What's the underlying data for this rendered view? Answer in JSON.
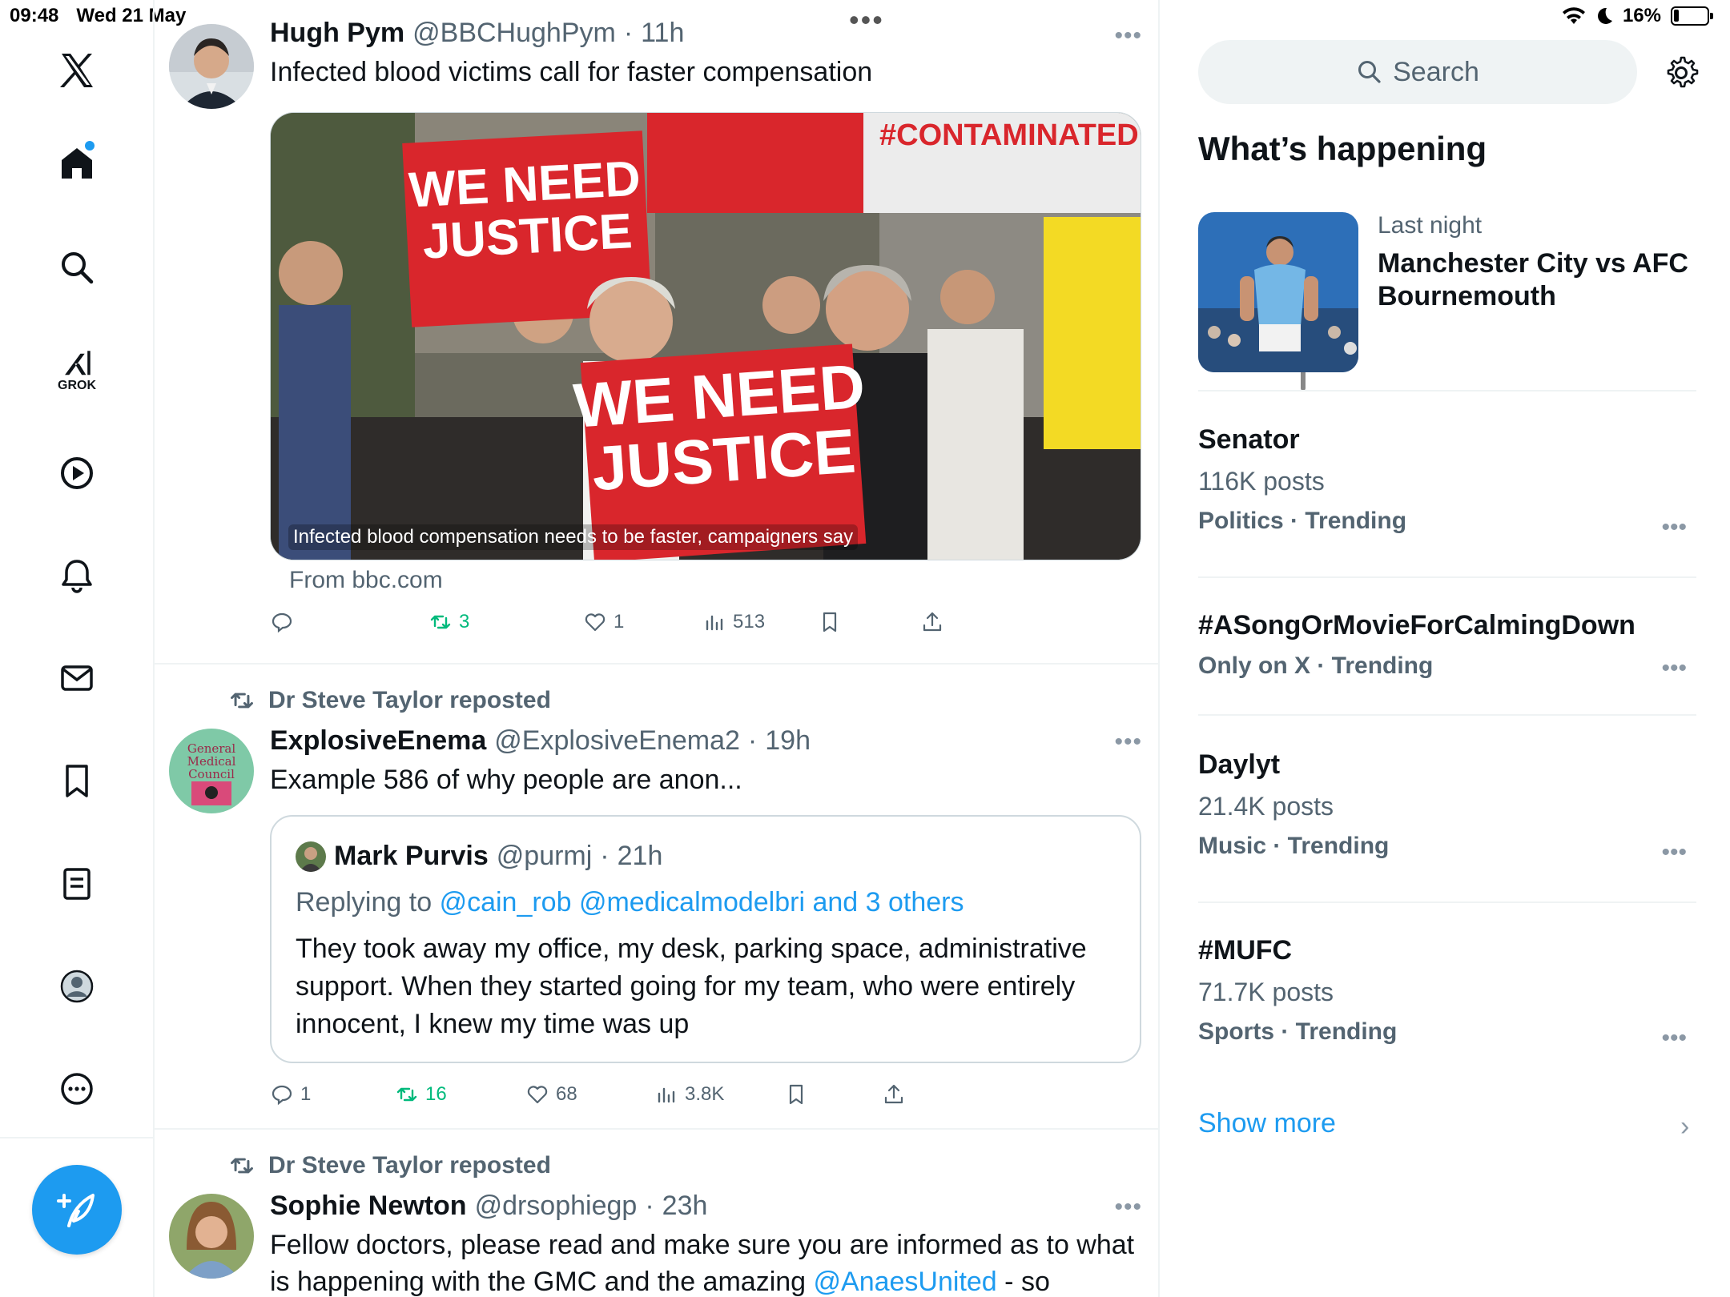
{
  "status": {
    "time": "09:48",
    "date": "Wed 21 May",
    "battery": "16%",
    "battery_level": 0.16
  },
  "nav": {
    "grok_label": "GROK"
  },
  "tweets": [
    {
      "name": "Hugh Pym",
      "handle": "@BBCHughPym",
      "sep": "·",
      "time": "11h",
      "text": "Infected blood victims call for faster compensation",
      "media_caption": "Infected blood compensation needs to be faster, campaigners say",
      "sign_text_1": "WE NEED JUSTICE",
      "sign_text_2": "#CONTAMINATEDBL",
      "from": "From bbc.com",
      "retweets": "3",
      "likes": "1",
      "views": "513"
    },
    {
      "reposted_by": "Dr Steve Taylor reposted",
      "name": "ExplosiveEnema",
      "handle": "@ExplosiveEnema2",
      "sep": "·",
      "time": "19h",
      "text": "Example 586 of why people are anon...",
      "quote": {
        "name": "Mark Purvis",
        "handle": "@purmj",
        "sep": "·",
        "time": "21h",
        "replying_prefix": "Replying to",
        "replying_links": "@cain_rob @medicalmodelbri and 3 others",
        "text": "They took away my office, my desk, parking space, administrative support. When they started going for my team, who were entirely innocent, I knew my time was up"
      },
      "replies": "1",
      "retweets": "16",
      "likes": "68",
      "views": "3.8K",
      "avatar_text": "General Medical Council"
    },
    {
      "reposted_by": "Dr Steve Taylor reposted",
      "name": "Sophie Newton",
      "handle": "@drsophiegp",
      "sep": "·",
      "time": "23h",
      "text_1": "Fellow doctors, please read and make sure you are informed as to what is happening with the GMC and the amazing",
      "link": "@AnaesUnited",
      "text_2": "- so"
    }
  ],
  "right": {
    "search_placeholder": "Search",
    "section_title": "What’s happening",
    "event": {
      "meta": "Last night",
      "title": "Manchester City vs AFC Bournemouth"
    },
    "trends": [
      {
        "name": "Senator",
        "posts": "116K posts",
        "category": "Politics · Trending"
      },
      {
        "name": "#ASongOrMovieForCalmingDown",
        "posts": "",
        "category": "Only on X · Trending"
      },
      {
        "name": "Daylyt",
        "posts": "21.4K posts",
        "category": "Music · Trending"
      },
      {
        "name": "#MUFC",
        "posts": "71.7K posts",
        "category": "Sports · Trending"
      }
    ],
    "show_more": "Show more"
  },
  "colors": {
    "accent": "#1d9bf0",
    "repost_green": "#00ba7c",
    "muted": "#536471",
    "border": "#eff3f4"
  }
}
